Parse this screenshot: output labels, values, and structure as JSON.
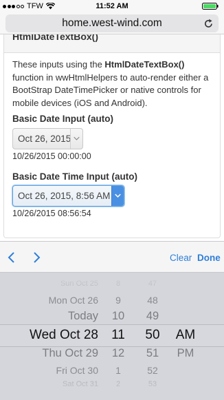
{
  "status_bar": {
    "carrier": "TFW",
    "time": "11:52 AM"
  },
  "browser": {
    "address": "home.west-wind.com"
  },
  "page": {
    "panel_title": "HtmlDateTextBox()",
    "intro_before": "These inputs using the ",
    "intro_bold": "HtmlDateTextBox()",
    "intro_after": " function in wwHtmlHelpers to auto-render either a BootStrap DateTimePicker or native controls for mobile devices (iOS and Android).",
    "date_input": {
      "label": "Basic Date Input (auto)",
      "value": "Oct 26, 2015",
      "helper": "10/26/2015 00:00:00"
    },
    "datetime_input": {
      "label": "Basic Date Time Input (auto)",
      "value": "Oct 26, 2015, 8:56 AM",
      "helper": "10/26/2015 08:56:54"
    }
  },
  "toolbar": {
    "clear_label": "Clear",
    "done_label": "Done"
  },
  "picker": {
    "days": [
      "Sun Oct 25",
      "Mon Oct 26",
      "Today",
      "Wed Oct 28",
      "Thu Oct 29",
      "Fri Oct 30",
      "Sat Oct 31"
    ],
    "hours": [
      "8",
      "9",
      "10",
      "11",
      "12",
      "1",
      "2"
    ],
    "minutes": [
      "47",
      "48",
      "49",
      "50",
      "51",
      "52",
      "53"
    ],
    "ampm": [
      "AM",
      "PM"
    ],
    "selected": {
      "day": "Wed Oct 28",
      "hour": "11",
      "minute": "50",
      "ampm": "AM"
    }
  },
  "colors": {
    "accent": "#2f7fd8",
    "picker_bg": "#d4d6db",
    "select_active": "#4a90e2"
  }
}
